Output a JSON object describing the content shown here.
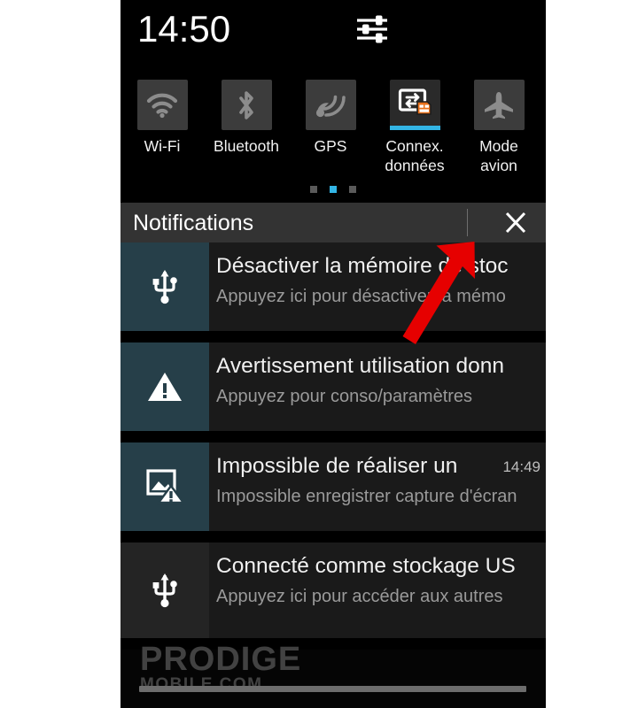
{
  "colors": {
    "accent_blue": "#33b5e5",
    "notif_icon_teal": "#263f49",
    "notif_row_bg": "#1a1a1a",
    "header_bg": "#333333",
    "tile_bg": "#3c3c3c",
    "sim_badge_orange": "#e8701a",
    "arrow_red": "#e60000",
    "screen_bg": "#000000"
  },
  "status_bar": {
    "clock": "14:50",
    "settings_icon": "sliders-icon"
  },
  "quick_toggles": {
    "items": [
      {
        "label": "Wi-Fi",
        "icon": "wifi-icon",
        "active": false
      },
      {
        "label": "Bluetooth",
        "icon": "bluetooth-icon",
        "active": false
      },
      {
        "label": "GPS",
        "icon": "gps-icon",
        "active": false
      },
      {
        "label": "Connex.\ndonnées",
        "label_line1": "Connex.",
        "label_line2": "données",
        "icon": "data-connection-icon",
        "active": true
      },
      {
        "label": "Mode\navion",
        "label_line1": "Mode",
        "label_line2": "avion",
        "icon": "airplane-icon",
        "active": false
      }
    ],
    "page_dots": {
      "count": 3,
      "active_index": 1
    }
  },
  "notifications_panel": {
    "title": "Notifications",
    "close_label": "close-icon",
    "items": [
      {
        "icon": "usb-icon",
        "icon_bg": "teal",
        "title": "Désactiver la mémoire de stoc",
        "subtitle": "Appuyez ici pour désactiver la mémo",
        "time": ""
      },
      {
        "icon": "warning-triangle-icon",
        "icon_bg": "teal",
        "title": "Avertissement utilisation donn",
        "subtitle": "Appuyez pour conso/paramètres",
        "time": ""
      },
      {
        "icon": "image-error-icon",
        "icon_bg": "teal",
        "title": "Impossible de réaliser un",
        "subtitle": "Impossible enregistrer capture d'écran",
        "time": "14:49"
      },
      {
        "icon": "usb-icon",
        "icon_bg": "plain",
        "title": "Connecté comme stockage US",
        "subtitle": "Appuyez ici pour accéder aux autres",
        "time": ""
      }
    ]
  },
  "footer": {
    "watermark_main": "PRODIGE",
    "watermark_sub": "MOBILE.COM",
    "drag_handle": "panel-drag-handle"
  },
  "annotation": {
    "arrow": "red-arrow-pointing-to-close-button"
  }
}
